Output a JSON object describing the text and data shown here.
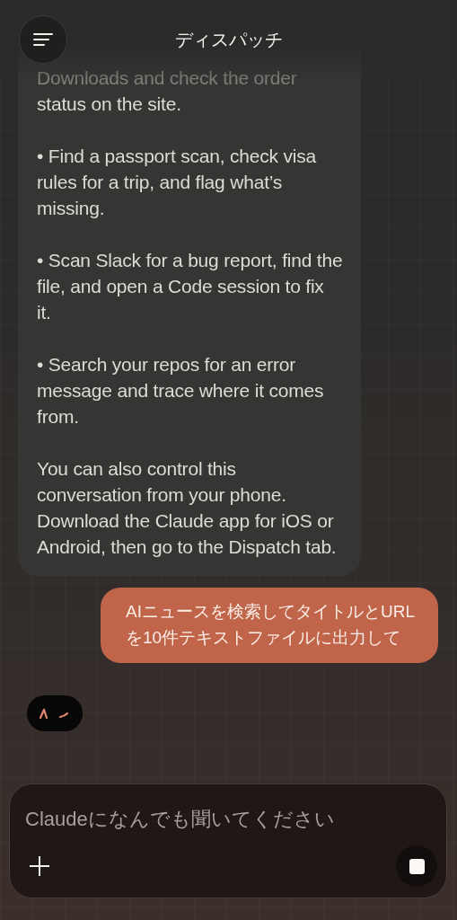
{
  "header": {
    "title": "ディスパッチ"
  },
  "assistant_message": {
    "paragraphs": [
      {
        "kind": "partial",
        "text": "Downloads and check the order status on the site."
      },
      {
        "kind": "text",
        "text": "• Find a passport scan, check visa rules for a trip, and flag what’s missing."
      },
      {
        "kind": "text",
        "text": "• Scan Slack for a bug report, find the file, and open a Code session to fix it."
      },
      {
        "kind": "text",
        "text": "• Search your repos for an error message and trace where it comes from."
      },
      {
        "kind": "text",
        "text": "You can also control this conversation from your phone. Download the Claude app for iOS or Android, then go to the Dispatch tab."
      }
    ]
  },
  "user_message": {
    "text": "AIニュースを検索してタイトルとURLを10件テキストファイルに出力して"
  },
  "status": {
    "kind": "thinking"
  },
  "composer": {
    "placeholder": "Claudeになんでも聞いてください"
  }
}
